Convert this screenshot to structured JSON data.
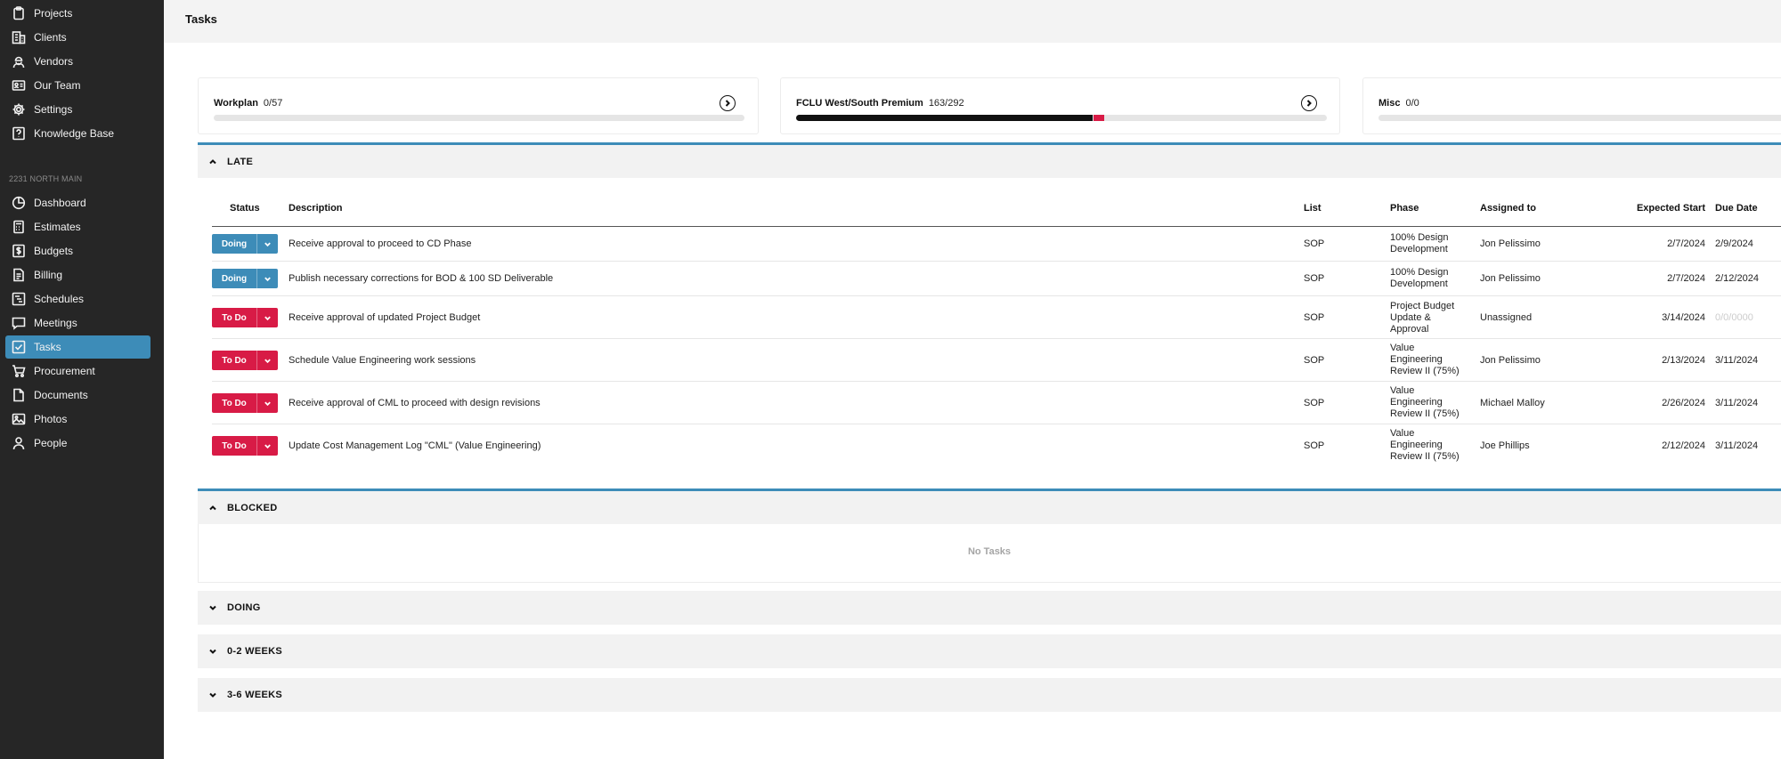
{
  "sidebar": {
    "top_items": [
      {
        "label": "Projects",
        "icon": "clipboard-icon"
      },
      {
        "label": "Clients",
        "icon": "building-icon"
      },
      {
        "label": "Vendors",
        "icon": "worker-icon"
      },
      {
        "label": "Our Team",
        "icon": "id-card-icon"
      },
      {
        "label": "Settings",
        "icon": "gear-icon"
      },
      {
        "label": "Knowledge Base",
        "icon": "question-icon"
      }
    ],
    "project_label": "2231 NORTH MAIN",
    "project_items": [
      {
        "label": "Dashboard",
        "icon": "pie-chart-icon"
      },
      {
        "label": "Estimates",
        "icon": "calculator-icon"
      },
      {
        "label": "Budgets",
        "icon": "dollar-icon"
      },
      {
        "label": "Billing",
        "icon": "invoice-icon"
      },
      {
        "label": "Schedules",
        "icon": "gantt-icon"
      },
      {
        "label": "Meetings",
        "icon": "chat-icon"
      },
      {
        "label": "Tasks",
        "icon": "checkbox-icon",
        "active": true
      },
      {
        "label": "Procurement",
        "icon": "cart-icon"
      },
      {
        "label": "Documents",
        "icon": "document-icon"
      },
      {
        "label": "Photos",
        "icon": "photo-icon"
      },
      {
        "label": "People",
        "icon": "person-icon"
      }
    ]
  },
  "header": {
    "title": "Tasks"
  },
  "cards": [
    {
      "name": "Workplan",
      "count": "0/57",
      "done": 0,
      "total": 57
    },
    {
      "name": "FCLU West/South Premium",
      "count": "163/292",
      "done": 163,
      "total": 292,
      "late": 6
    },
    {
      "name": "Misc",
      "count": "0/0",
      "done": 0,
      "total": 0
    }
  ],
  "sections": {
    "late": "LATE",
    "blocked": "BLOCKED",
    "doing": "DOING",
    "weeks_0_2": "0-2 WEEKS",
    "weeks_3_6": "3-6 WEEKS"
  },
  "columns": {
    "status": "Status",
    "description": "Description",
    "list": "List",
    "phase": "Phase",
    "assigned": "Assigned to",
    "expected_start": "Expected Start",
    "due_date": "Due Date"
  },
  "tasks": [
    {
      "status": "Doing",
      "description": "Receive approval to proceed to CD Phase",
      "list": "SOP",
      "phase": "100% Design Development",
      "assigned": "Jon Pelissimo",
      "expected_start": "2/7/2024",
      "due_date": "2/9/2024"
    },
    {
      "status": "Doing",
      "description": "Publish necessary corrections for BOD & 100 SD Deliverable",
      "list": "SOP",
      "phase": "100% Design Development",
      "assigned": "Jon Pelissimo",
      "expected_start": "2/7/2024",
      "due_date": "2/12/2024"
    },
    {
      "status": "To Do",
      "description": "Receive approval of updated Project Budget",
      "list": "SOP",
      "phase": "Project Budget Update & Approval",
      "assigned": "Unassigned",
      "expected_start": "3/14/2024",
      "due_date": "0/0/0000"
    },
    {
      "status": "To Do",
      "description": "Schedule Value Engineering work sessions",
      "list": "SOP",
      "phase": "Value Engineering Review II (75%)",
      "assigned": "Jon Pelissimo",
      "expected_start": "2/13/2024",
      "due_date": "3/11/2024"
    },
    {
      "status": "To Do",
      "description": "Receive approval of CML to proceed with design revisions",
      "list": "SOP",
      "phase": "Value Engineering Review II (75%)",
      "assigned": "Michael Malloy",
      "expected_start": "2/26/2024",
      "due_date": "3/11/2024"
    },
    {
      "status": "To Do",
      "description": "Update Cost Management Log \"CML\" (Value Engineering)",
      "list": "SOP",
      "phase": "Value Engineering Review II (75%)",
      "assigned": "Joe Phillips",
      "expected_start": "2/12/2024",
      "due_date": "3/11/2024"
    }
  ],
  "blocked_empty": "No Tasks",
  "colors": {
    "accent": "#3d8cb8",
    "todo": "#d81b46",
    "sidebar": "#262626"
  }
}
